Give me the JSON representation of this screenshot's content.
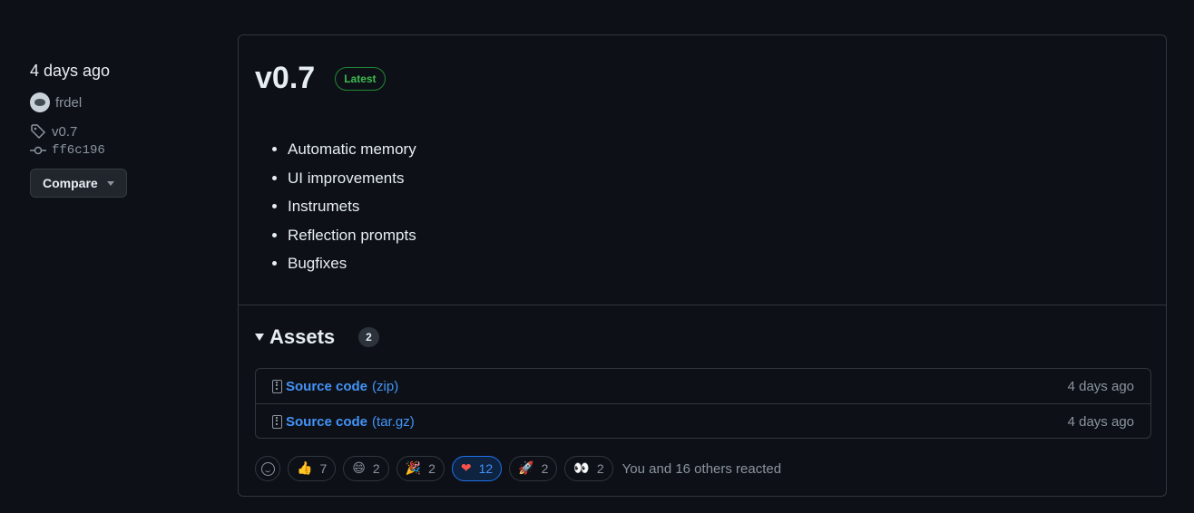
{
  "sidebar": {
    "date": "4 days ago",
    "author": "frdel",
    "tag": "v0.7",
    "commit": "ff6c196",
    "compare_label": "Compare"
  },
  "release": {
    "title": "v0.7",
    "badge": "Latest",
    "notes": [
      "Automatic memory",
      "UI improvements",
      "Instrumets",
      "Reflection prompts",
      "Bugfixes"
    ]
  },
  "assets": {
    "title": "Assets",
    "count": "2",
    "items": [
      {
        "name": "Source code",
        "ext": "(zip)",
        "date": "4 days ago"
      },
      {
        "name": "Source code",
        "ext": "(tar.gz)",
        "date": "4 days ago"
      }
    ]
  },
  "reactions": {
    "items": [
      {
        "icon": "thumbs-up-icon",
        "emoji": "👍",
        "count": "7",
        "active": false
      },
      {
        "icon": "laugh-icon",
        "emoji": "😄",
        "count": "2",
        "active": false
      },
      {
        "icon": "hooray-icon",
        "emoji": "🎉",
        "count": "2",
        "active": false
      },
      {
        "icon": "heart-icon",
        "emoji": "❤",
        "count": "12",
        "active": true
      },
      {
        "icon": "rocket-icon",
        "emoji": "🚀",
        "count": "2",
        "active": false
      },
      {
        "icon": "eyes-icon",
        "emoji": "👀",
        "count": "2",
        "active": false
      }
    ],
    "summary": "You and 16 others reacted"
  },
  "colors": {
    "background": "#0d1117",
    "border": "#30363d",
    "link": "#4493f8",
    "latest_green": "#3fb950",
    "active_reaction": "#1f6feb"
  }
}
